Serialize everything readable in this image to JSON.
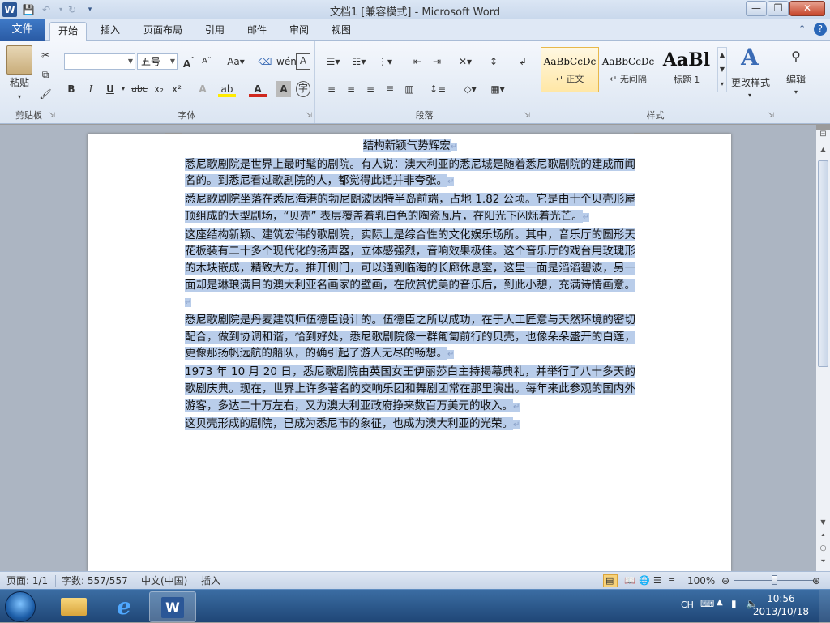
{
  "window": {
    "title": "文档1 [兼容模式] - Microsoft Word",
    "minimize": "—",
    "maximize": "❐",
    "close": "✕"
  },
  "ribbon": {
    "file_tab": "文件",
    "tabs": [
      "开始",
      "插入",
      "页面布局",
      "引用",
      "邮件",
      "审阅",
      "视图"
    ],
    "clipboard": {
      "paste_label": "粘贴",
      "group_label": "剪贴板"
    },
    "font": {
      "font_name": "",
      "font_size": "五号",
      "group_label": "字体"
    },
    "paragraph": {
      "group_label": "段落"
    },
    "styles": {
      "group_label": "样式",
      "items": [
        {
          "sample": "AaBbCcDc",
          "name": "↵ 正文"
        },
        {
          "sample": "AaBbCcDc",
          "name": "↵ 无间隔"
        },
        {
          "sample": "AaBl",
          "name": "标题 1"
        }
      ],
      "change_styles": "更改样式"
    },
    "editing": {
      "label": "编辑"
    }
  },
  "document": {
    "title": "结构新颖气势辉宏",
    "paragraphs": [
      "悉尼歌剧院是世界上最时髦的剧院。有人说：澳大利亚的悉尼城是随着悉尼歌剧院的建成而闻名的。到悉尼看过歌剧院的人，都觉得此话并非夸张。",
      "悉尼歌剧院坐落在悉尼海港的勃尼朗波因特半岛前端，占地 1.82 公顷。它是由十个贝壳形屋顶组成的大型剧场，“贝壳” 表层覆盖着乳白色的陶瓷瓦片，在阳光下闪烁着光芒。",
      "这座结构新颖、建筑宏伟的歌剧院，实际上是综合性的文化娱乐场所。其中，音乐厅的圆形天花板装有二十多个现代化的扬声器，立体感强烈，音响效果极佳。这个音乐厅的戏台用玫瑰形的木块嵌成，精致大方。推开侧门，可以通到临海的长廊休息室，这里一面是滔滔碧波，另一面却是琳琅满目的澳大利亚名画家的壁画，在欣赏优美的音乐后，到此小憩，充满诗情画意。",
      "悉尼歌剧院是丹麦建筑师伍德臣设计的。伍德臣之所以成功，在于人工匠意与天然环境的密切配合，做到协调和谐，恰到好处，悉尼歌剧院像一群匍匐前行的贝壳，也像朵朵盛开的白莲，更像那扬帆远航的船队，的确引起了游人无尽的畅想。",
      "1973 年 10 月 20 日，悉尼歌剧院由英国女王伊丽莎白主持揭幕典礼，并举行了八十多天的歌剧庆典。现在，世界上许多著名的交响乐团和舞剧团常在那里演出。每年来此参观的国内外游客，多达二十万左右，又为澳大利亚政府挣来数百万美元的收入。",
      "这贝壳形成的剧院，已成为悉尼市的象征，也成为澳大利亚的光荣。"
    ]
  },
  "status": {
    "page": "页面: 1/1",
    "words": "字数: 557/557",
    "language": "中文(中国)",
    "mode": "插入",
    "zoom": "100%",
    "zoom_value": 1.0
  },
  "taskbar": {
    "lang": "CH",
    "time": "10:56",
    "date": "2013/10/18"
  },
  "colors": {
    "selection": "#b9cdea",
    "file_tab": "#2a5ba5",
    "taskbar": "#1f4676"
  }
}
